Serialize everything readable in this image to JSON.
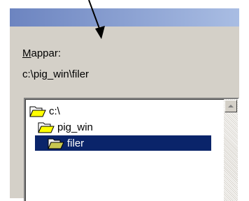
{
  "dialog": {
    "folders_label_accesskey": "M",
    "folders_label_rest": "appar:",
    "current_path": "c:\\pig_win\\filer"
  },
  "tree": {
    "items": [
      {
        "label": "c:\\",
        "icon": "open-folder-icon",
        "selected": false
      },
      {
        "label": "pig_win",
        "icon": "open-folder-icon",
        "selected": false
      },
      {
        "label": "filer",
        "icon": "open-folder-icon",
        "selected": true
      }
    ]
  },
  "colors": {
    "selection": "#0a246a",
    "titlebar_start": "#6c84c0",
    "titlebar_end": "#a9bde3",
    "dialog_face": "#d4d0c8",
    "folder_fill": "#ffff00"
  },
  "icons": {
    "scroll_up": "triangle-up-icon",
    "annotation": "arrow-icon"
  }
}
